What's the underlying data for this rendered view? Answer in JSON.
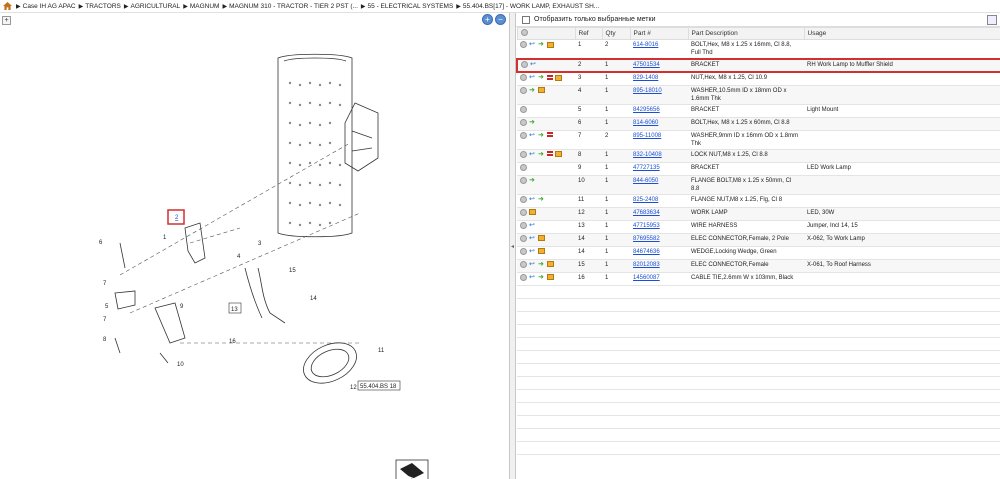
{
  "breadcrumb": [
    "Case IH AG APAC",
    "TRACTORS",
    "AGRICULTURAL",
    "MAGNUM",
    "MAGNUM 310 - TRACTOR - TIER 2 PST (...",
    "55 - ELECTRICAL SYSTEMS",
    "55.404.BS[17] - WORK LAMP, EXHAUST SH..."
  ],
  "filter": {
    "label": "Отобразить только выбранные метки"
  },
  "columns": {
    "ref": "Ref",
    "qty": "Qty",
    "part": "Part #",
    "desc": "Part Description",
    "usage": "Usage"
  },
  "diagram": {
    "labels": [
      "1",
      "2",
      "3",
      "4",
      "5",
      "6",
      "7",
      "7",
      "8",
      "9",
      "10",
      "11",
      "12",
      "13",
      "14",
      "15",
      "16"
    ],
    "tag12": "55.404.BS 18"
  },
  "rows": [
    {
      "ref": "1",
      "qty": "2",
      "part": "614-8016",
      "desc": "BOLT,Hex, M8 x 1.25 x 16mm, Cl 8.8, Full Thd",
      "usage": "",
      "icons": [
        "circle",
        "arrow",
        "green",
        "box"
      ]
    },
    {
      "ref": "2",
      "qty": "1",
      "part": "47501534",
      "desc": "BRACKET",
      "usage": "RH Work Lamp to Muffler Shield",
      "icons": [
        "circle",
        "arrow"
      ],
      "selected": true
    },
    {
      "ref": "3",
      "qty": "1",
      "part": "829-1408",
      "desc": "NUT,Hex, M8 x 1.25, Cl 10.9",
      "usage": "",
      "icons": [
        "circle",
        "arrow",
        "green",
        "red",
        "box"
      ]
    },
    {
      "ref": "4",
      "qty": "1",
      "part": "895-18010",
      "desc": "WASHER,10.5mm ID x 18mm OD x 1.6mm Thk",
      "usage": "",
      "icons": [
        "circle",
        "green",
        "box"
      ]
    },
    {
      "ref": "5",
      "qty": "1",
      "part": "84295656",
      "desc": "BRACKET",
      "usage": "Light Mount",
      "icons": [
        "circle"
      ]
    },
    {
      "ref": "6",
      "qty": "1",
      "part": "814-6060",
      "desc": "BOLT,Hex, M8 x 1.25 x 60mm, Cl 8.8",
      "usage": "",
      "icons": [
        "circle",
        "green"
      ]
    },
    {
      "ref": "7",
      "qty": "2",
      "part": "895-11008",
      "desc": "WASHER,9mm ID x 16mm OD x 1.8mm Thk",
      "usage": "",
      "icons": [
        "circle",
        "arrow",
        "green",
        "red"
      ]
    },
    {
      "ref": "8",
      "qty": "1",
      "part": "832-10408",
      "desc": "LOCK NUT,M8 x 1.25, Cl 8.8",
      "usage": "",
      "icons": [
        "circle",
        "arrow",
        "green",
        "red",
        "box"
      ]
    },
    {
      "ref": "9",
      "qty": "1",
      "part": "47727135",
      "desc": "BRACKET",
      "usage": "LED Work Lamp",
      "icons": [
        "circle"
      ]
    },
    {
      "ref": "10",
      "qty": "1",
      "part": "844-6050",
      "desc": "FLANGE BOLT,M8 x 1.25 x 50mm, Cl 8.8",
      "usage": "",
      "icons": [
        "circle",
        "green"
      ]
    },
    {
      "ref": "11",
      "qty": "1",
      "part": "825-2408",
      "desc": "FLANGE NUT,M8 x 1.25, Flg, Cl 8",
      "usage": "",
      "icons": [
        "circle",
        "arrow",
        "green"
      ]
    },
    {
      "ref": "12",
      "qty": "1",
      "part": "47683634",
      "desc": "WORK LAMP",
      "usage": "LED, 30W",
      "icons": [
        "circle",
        "box"
      ]
    },
    {
      "ref": "13",
      "qty": "1",
      "part": "47715953",
      "desc": "WIRE HARNESS",
      "usage": "Jumper, Incl 14, 15",
      "icons": [
        "circle",
        "arrow"
      ]
    },
    {
      "ref": "14",
      "qty": "1",
      "part": "87695582",
      "desc": "ELEC CONNECTOR,Female, 2 Pole",
      "usage": "X-062, To Work Lamp",
      "icons": [
        "circle",
        "arrow",
        "box"
      ]
    },
    {
      "ref": "14",
      "qty": "1",
      "part": "84674636",
      "desc": "WEDGE,Locking Wedge, Green",
      "usage": "",
      "icons": [
        "circle",
        "arrow",
        "box"
      ]
    },
    {
      "ref": "15",
      "qty": "1",
      "part": "82012083",
      "desc": "ELEC CONNECTOR,Female",
      "usage": "X-061, To Roof Harness",
      "icons": [
        "circle",
        "arrow",
        "green",
        "box"
      ]
    },
    {
      "ref": "16",
      "qty": "1",
      "part": "14560087",
      "desc": "CABLE TIE,2.6mm W x 103mm, Black",
      "usage": "",
      "icons": [
        "circle",
        "arrow",
        "green",
        "box"
      ]
    }
  ]
}
